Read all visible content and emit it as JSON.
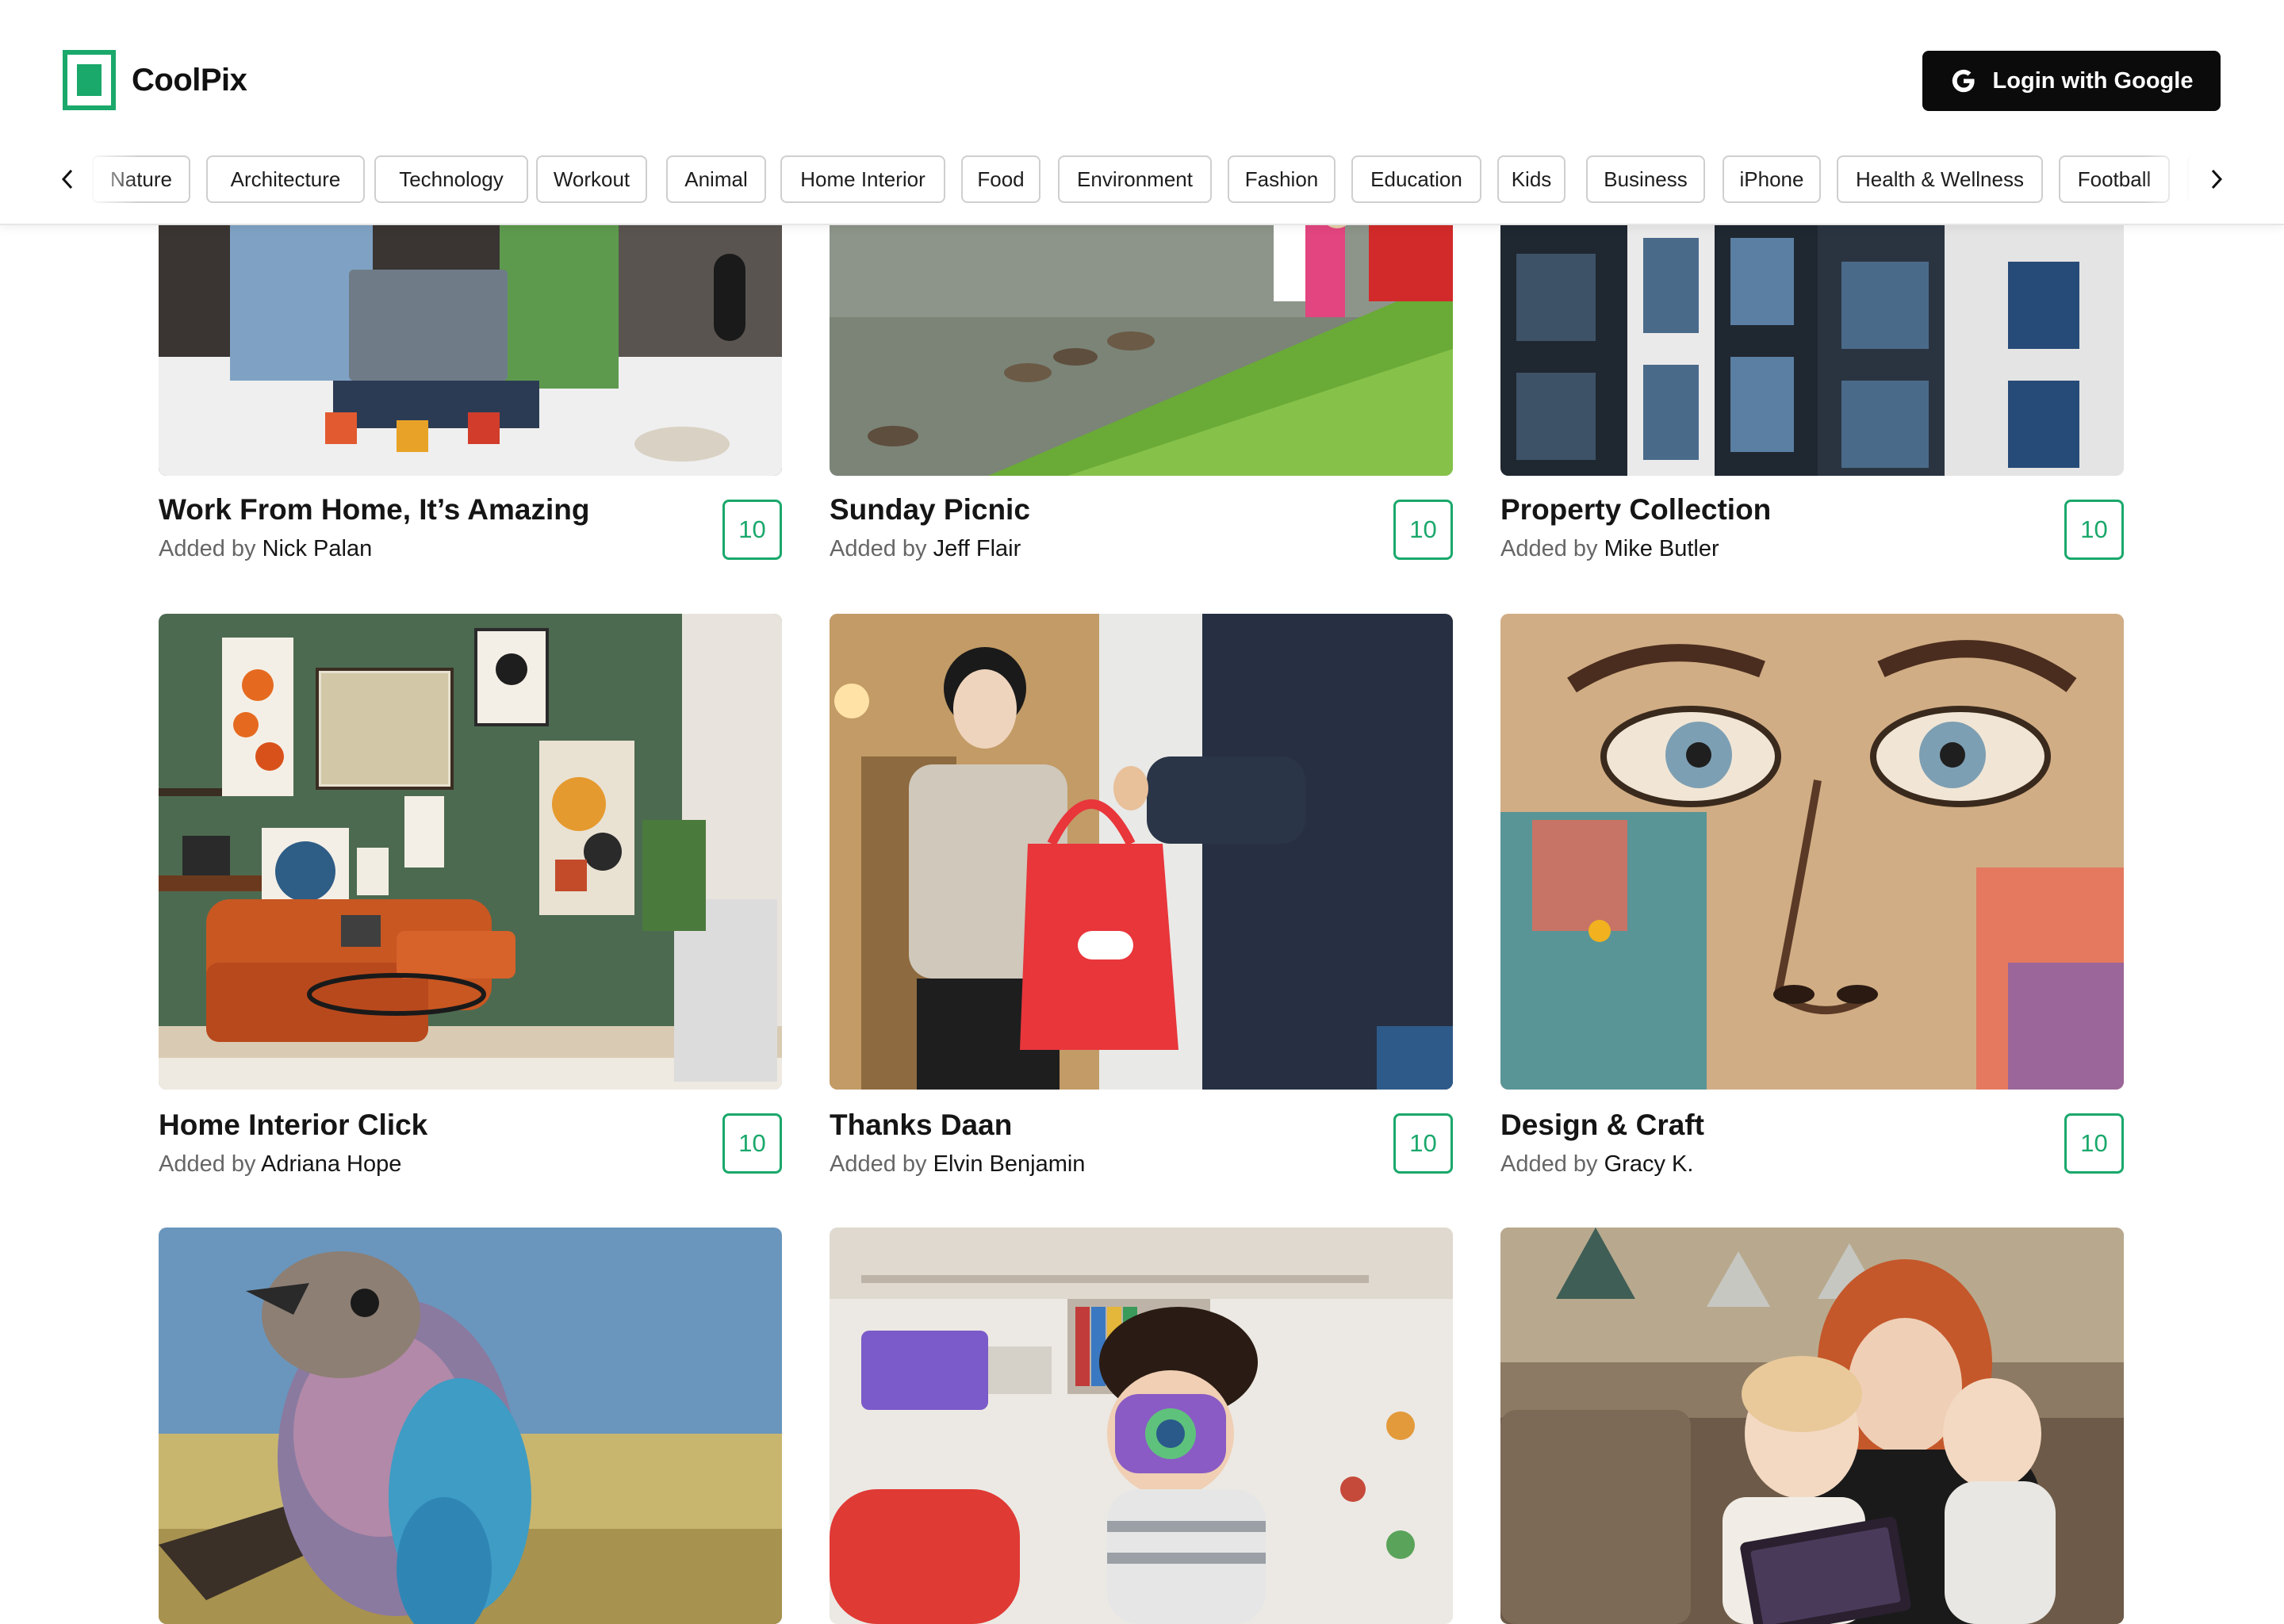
{
  "app": {
    "name": "CoolPix",
    "brand_color": "#1aa86b"
  },
  "header": {
    "login_label": "Login with Google"
  },
  "categories": [
    "Nature",
    "Architecture",
    "Technology",
    "Workout",
    "Animal",
    "Home Interior",
    "Food",
    "Environment",
    "Fashion",
    "Education",
    "Kids",
    "Business",
    "iPhone",
    "Health & Wellness",
    "Football"
  ],
  "added_by_prefix": "Added by",
  "cards": [
    {
      "title": "Work From Home, It’s Amazing",
      "author": "Nick Palan",
      "count": "10",
      "image": "couple-laptop-bed-photo"
    },
    {
      "title": "Sunday Picnic",
      "author": "Jeff Flair",
      "count": "10",
      "image": "lake-ducks-picnic-photo"
    },
    {
      "title": "Property Collection",
      "author": "Mike Butler",
      "count": "10",
      "image": "modern-building-photo"
    },
    {
      "title": "Home Interior Click",
      "author": "Adriana Hope",
      "count": "10",
      "image": "living-room-photo"
    },
    {
      "title": "Thanks Daan",
      "author": "Elvin Benjamin",
      "count": "10",
      "image": "delivery-bag-photo"
    },
    {
      "title": "Design & Craft",
      "author": "Gracy K.",
      "count": "10",
      "image": "face-mural-photo"
    },
    {
      "title": "",
      "author": "",
      "count": "",
      "image": "colorful-bird-photo"
    },
    {
      "title": "",
      "author": "",
      "count": "",
      "image": "child-toy-camera-photo"
    },
    {
      "title": "",
      "author": "",
      "count": "",
      "image": "mother-kids-tablet-photo"
    }
  ]
}
